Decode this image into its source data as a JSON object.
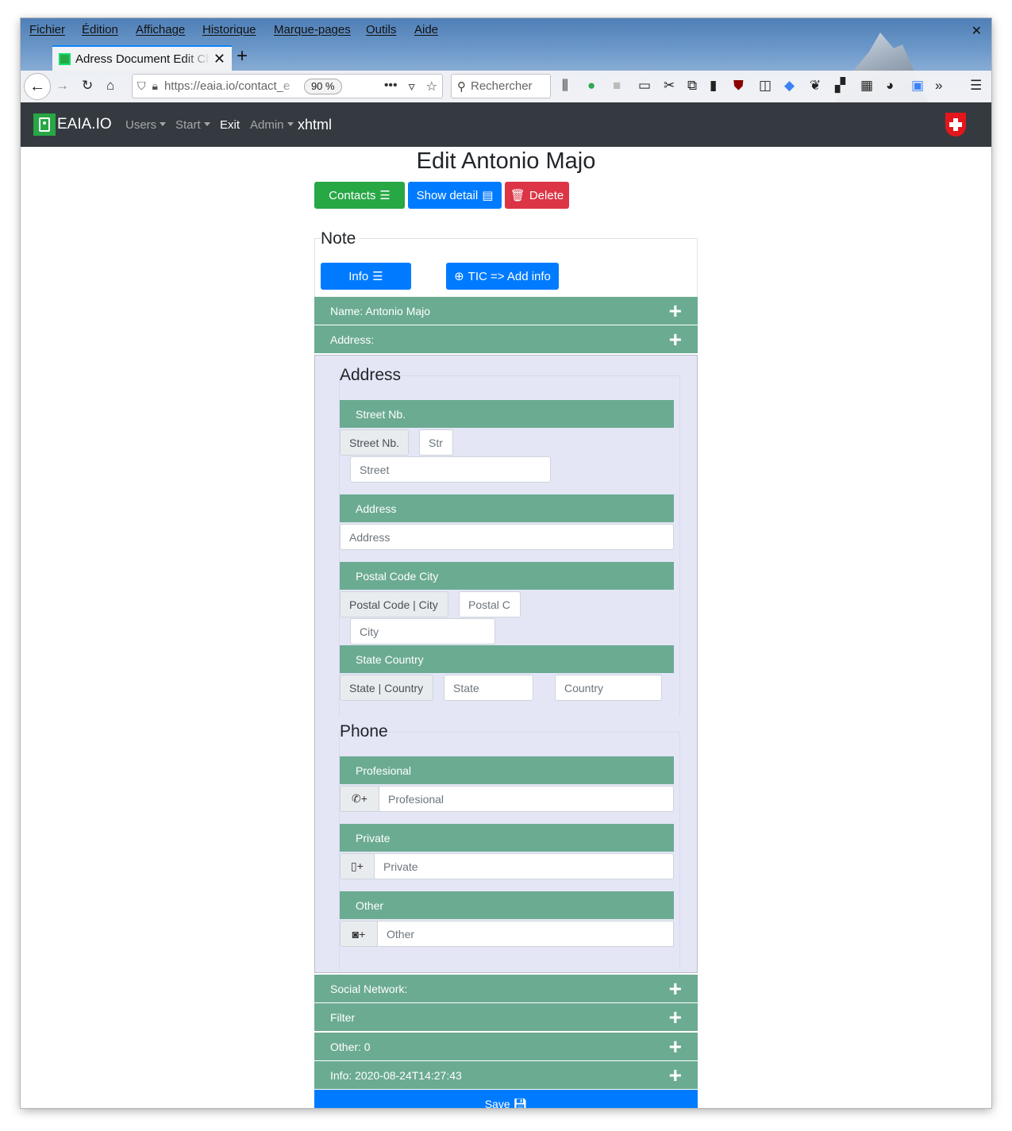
{
  "browser": {
    "menu": [
      "Fichier",
      "Édition",
      "Affichage",
      "Historique",
      "Marque-pages",
      "Outils",
      "Aide"
    ],
    "tab_title": "Adress Document Edit Ch",
    "url": "https://eaia.io/contact_e",
    "zoom": "90 %",
    "search_placeholder": "Rechercher"
  },
  "navbar": {
    "brand": "EAIA.IO",
    "users": "Users",
    "start": "Start",
    "exit": "Exit",
    "admin": "Admin",
    "xhtml": "xhtml"
  },
  "page": {
    "title": "Edit Antonio Majo",
    "contacts_button": "Contacts",
    "show_detail_button": "Show detail",
    "delete_button": "Delete",
    "note_legend": "Note",
    "info_button": "Info",
    "tic_button": "TIC => Add info"
  },
  "bars": {
    "name": "Name: Antonio Majo",
    "address": "Address:",
    "social": "Social Network:",
    "filter": "Filter",
    "other": "Other: 0",
    "info": "Info: 2020-08-24T14:27:43",
    "save": "Save"
  },
  "address": {
    "title": "Address",
    "street_nb_header": "Street Nb.",
    "street_nb_addon": "Street Nb.",
    "street_nb_placeholder": "Str",
    "street_placeholder": "Street",
    "address_header": "Address",
    "address_placeholder": "Address",
    "postal_header": "Postal Code City",
    "postal_addon": "Postal Code | City",
    "postal_placeholder": "Postal C",
    "city_placeholder": "City",
    "state_header": "State Country",
    "state_addon": "State | Country",
    "state_placeholder": "State",
    "country_placeholder": "Country"
  },
  "phone": {
    "title": "Phone",
    "profesional_header": "Profesional",
    "profesional_placeholder": "Profesional",
    "private_header": "Private",
    "private_placeholder": "Private",
    "other_header": "Other",
    "other_placeholder": "Other"
  },
  "colors": {
    "bar_green": "#6bab92",
    "navbar_dark": "#343a40",
    "primary_blue": "#007bff",
    "success_green": "#28a745",
    "danger_red": "#dc3545"
  }
}
